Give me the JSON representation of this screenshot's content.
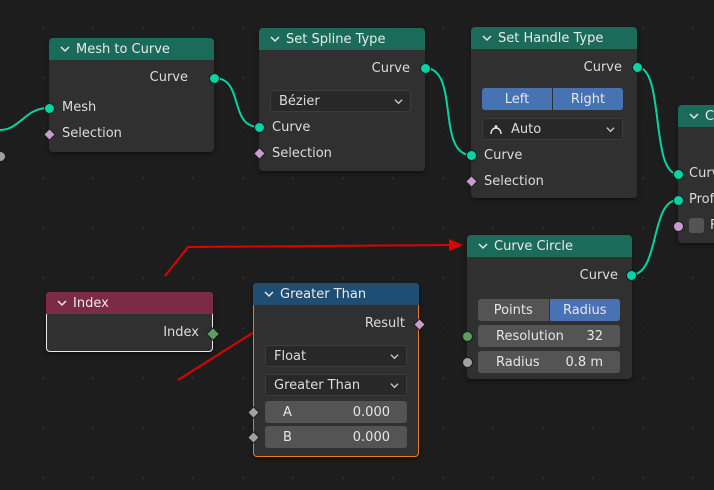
{
  "colors": {
    "teal_socket": "#00d6a3",
    "geometry_header": "#1b6b5a",
    "input_header": "#7c2b45",
    "function_header": "#1f4e75",
    "arrow": "#e00000",
    "selected_button": "#4772b3"
  },
  "nodes": {
    "mesh_to_curve": {
      "title": "Mesh to Curve",
      "output_curve": "Curve",
      "input_mesh": "Mesh",
      "input_selection": "Selection"
    },
    "set_spline_type": {
      "title": "Set Spline Type",
      "output_curve": "Curve",
      "type_value": "Bézier",
      "input_curve": "Curve",
      "input_selection": "Selection"
    },
    "set_handle_type": {
      "title": "Set Handle Type",
      "output_curve": "Curve",
      "btn_left": "Left",
      "btn_right": "Right",
      "handle_value": "Auto",
      "input_curve": "Curve",
      "input_selection": "Selection"
    },
    "partial": {
      "title_fragment": "C",
      "row1": "Curv",
      "row2": "Prof",
      "row3": "F"
    },
    "index": {
      "title": "Index",
      "output_index": "Index"
    },
    "greater_than": {
      "title": "Greater Than",
      "output_result": "Result",
      "data_type": "Float",
      "operation": "Greater Than",
      "a_label": "A",
      "a_value": "0.000",
      "b_label": "B",
      "b_value": "0.000"
    },
    "curve_circle": {
      "title": "Curve Circle",
      "output_curve": "Curve",
      "btn_points": "Points",
      "btn_radius": "Radius",
      "resolution_label": "Resolution",
      "resolution_value": "32",
      "radius_label": "Radius",
      "radius_value": "0.8 m"
    }
  }
}
